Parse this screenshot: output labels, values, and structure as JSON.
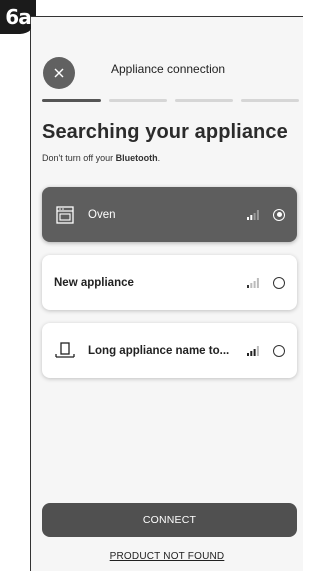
{
  "step_badge": "6a",
  "header": {
    "title": "Appliance connection",
    "close_icon": "close-icon"
  },
  "progress": {
    "total_steps": 4,
    "current_step": 1
  },
  "headline": "Searching your appliance",
  "subtitle": {
    "prefix": "Don't turn off your ",
    "emphasis": "Bluetooth",
    "suffix": "."
  },
  "appliances": [
    {
      "name": "Oven",
      "icon": "oven-icon",
      "selected": true
    },
    {
      "name": "New appliance",
      "icon": "none",
      "selected": false
    },
    {
      "name": "Long appliance name to...",
      "icon": "range-hood-icon",
      "selected": false
    }
  ],
  "connect_label": "CONNECT",
  "not_found_label": "PRODUCT NOT FOUND",
  "colors": {
    "selected_card": "#5e5e5e",
    "connect_button": "#505050",
    "close_button": "#616161"
  }
}
